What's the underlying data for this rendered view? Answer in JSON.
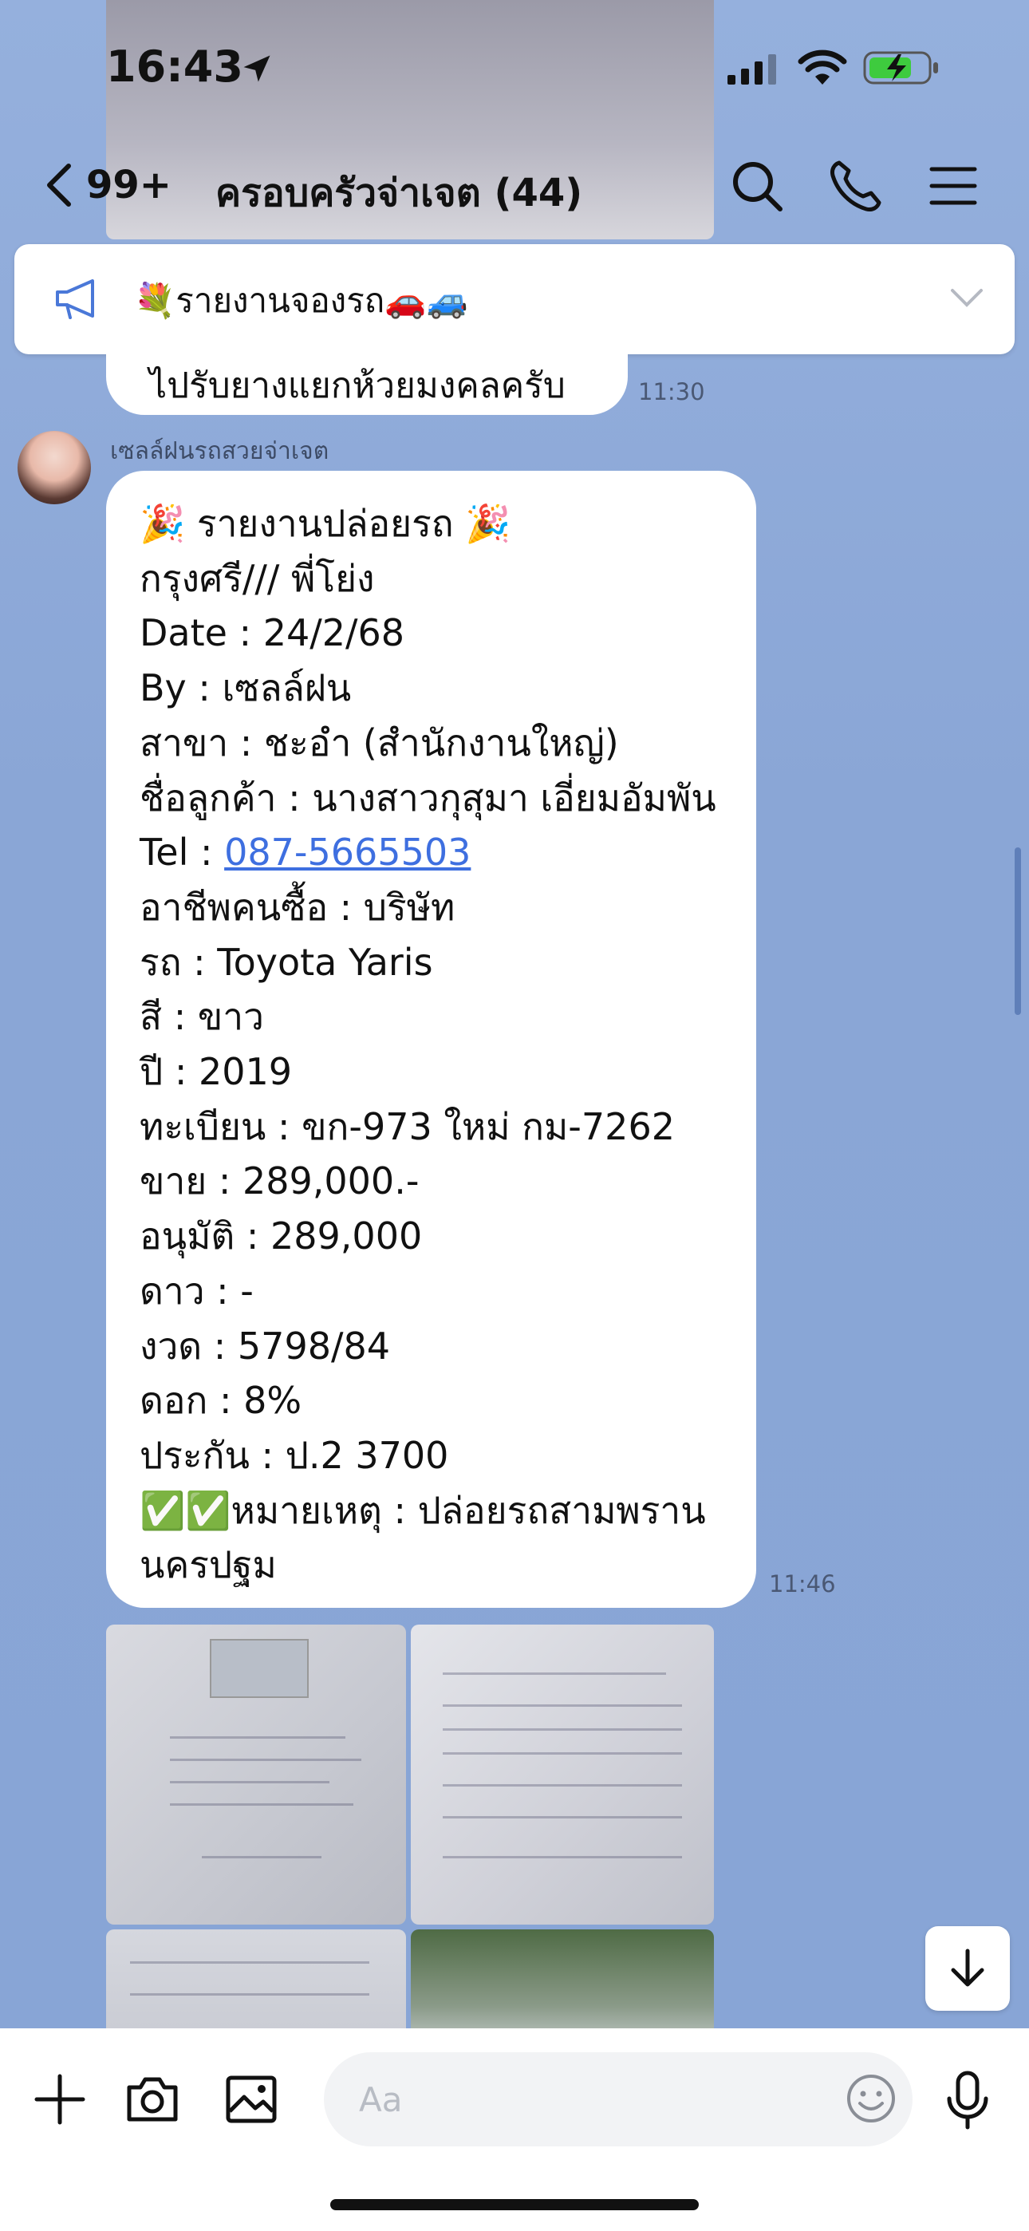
{
  "status_bar": {
    "time": "16:43"
  },
  "header": {
    "unread_count": "99+",
    "title": "ครอบครัวจ่าเจต (44)"
  },
  "announcement": {
    "text": "💐รายงานจองรถ🚗🚙"
  },
  "previous_message": {
    "text": "ไปรับยางแยกห้วยมงคลครับ",
    "time": "11:30"
  },
  "message": {
    "sender": "เซลล์ฝนรถสวยจ่าเจต",
    "time": "11:46",
    "lines": [
      "🎉 รายงานปล่อยรถ 🎉",
      "กรุงศรี/// พี่โย่ง",
      "Date : 24/2/68",
      "By : เซลล์ฝน",
      "สาขา : ชะอำ (สำนักงานใหญ่)",
      "ชื่อลูกค้า : นางสาวกุสุมา เอี่ยมอัมพัน",
      "Tel : ",
      "อาชีพคนซื้อ : บริษัท",
      "รถ : Toyota Yaris",
      "สี : ขาว",
      "ปี : 2019",
      "ทะเบียน : ขก-973 ใหม่ กม-7262",
      "ขาย : 289,000.-",
      "อนุมัติ : 289,000",
      "ดาว : -",
      "งวด : 5798/84",
      "ดอก : 8%",
      "ประกัน :  ป.2 3700",
      "✅✅หมายเหตุ : ปล่อยรถสามพราน",
      "นครปฐม"
    ],
    "tel_link": "087-5665503"
  },
  "input": {
    "placeholder": "Aa"
  },
  "colors": {
    "background": "#8fa9d8",
    "link": "#3e6fe0",
    "battery_green": "#3ecb3e"
  }
}
